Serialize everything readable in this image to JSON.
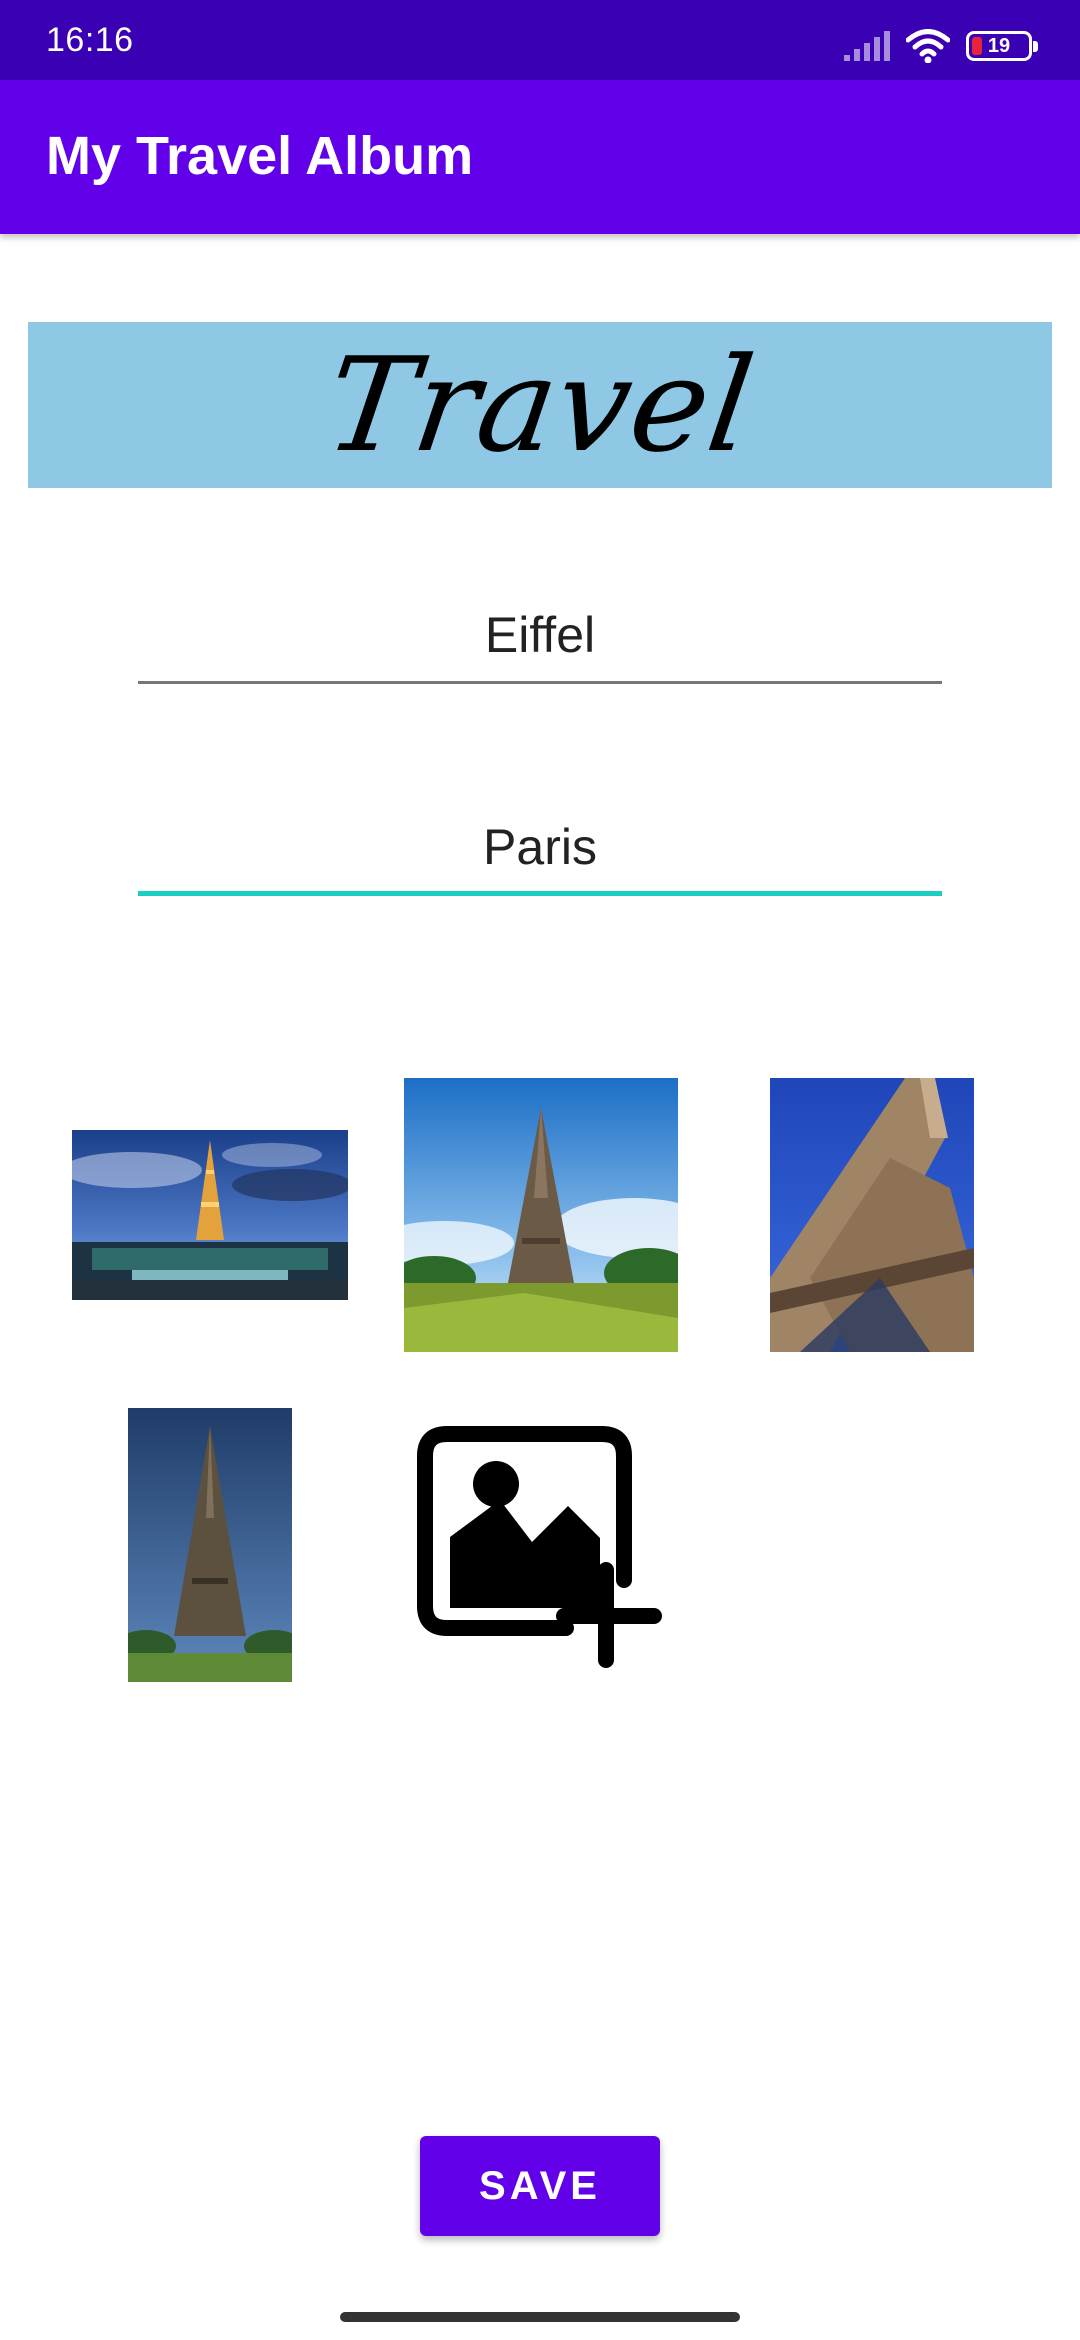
{
  "status_bar": {
    "time": "16:16",
    "battery_level": "19",
    "battery_fraction": 0.19,
    "battery_color": "#e8243c",
    "icons": [
      "signal-icon",
      "wifi-icon",
      "battery-icon"
    ]
  },
  "app_bar": {
    "title": "My Travel Album",
    "color": "#6200ea"
  },
  "banner": {
    "text": "Travel",
    "background": "#8ec8e4"
  },
  "form": {
    "name_value": "Eiffel",
    "city_value": "Paris",
    "focused_underline_color": "#1ccdc1"
  },
  "photos": [
    {
      "name": "photo-eiffel-night"
    },
    {
      "name": "photo-eiffel-park"
    },
    {
      "name": "photo-eiffel-closeup"
    },
    {
      "name": "photo-eiffel-portrait"
    }
  ],
  "add_photo": {
    "icon": "add-photo-icon"
  },
  "save_button": {
    "label": "SAVE"
  }
}
